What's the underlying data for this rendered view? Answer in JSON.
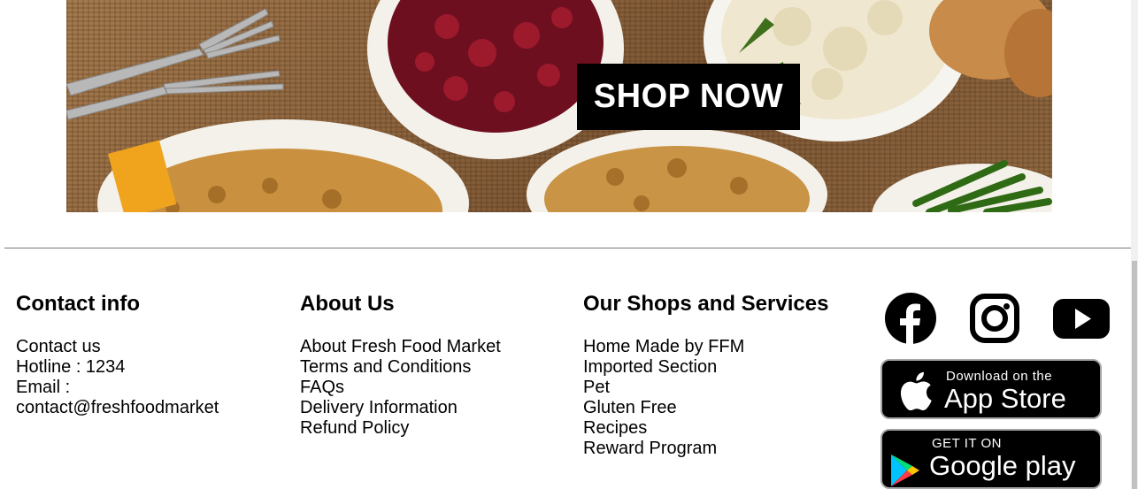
{
  "hero": {
    "cta_label": "SHOP NOW"
  },
  "footer": {
    "contact": {
      "heading": "Contact info",
      "lines": [
        "Contact us",
        "Hotline : 1234",
        "Email :",
        "contact@freshfoodmarket"
      ]
    },
    "about": {
      "heading": "About Us",
      "links": [
        "About Fresh Food Market",
        "Terms and Conditions",
        "FAQs",
        "Delivery Information",
        "Refund Policy"
      ]
    },
    "shops": {
      "heading": "Our Shops and Services",
      "links": [
        "Home Made by FFM",
        "Imported Section",
        "Pet",
        "Gluten Free",
        "Recipes",
        "Reward Program"
      ]
    },
    "social": {
      "icons": [
        "facebook-icon",
        "instagram-icon",
        "youtube-icon"
      ]
    },
    "badges": {
      "app_store": {
        "small": "Download on the",
        "big": "App Store"
      },
      "google_play": {
        "small": "GET IT ON",
        "big": "Google play"
      }
    }
  },
  "colors": {
    "background": "#ffffff",
    "text": "#000000",
    "cta_bg": "#000000",
    "cta_text": "#ffffff"
  }
}
